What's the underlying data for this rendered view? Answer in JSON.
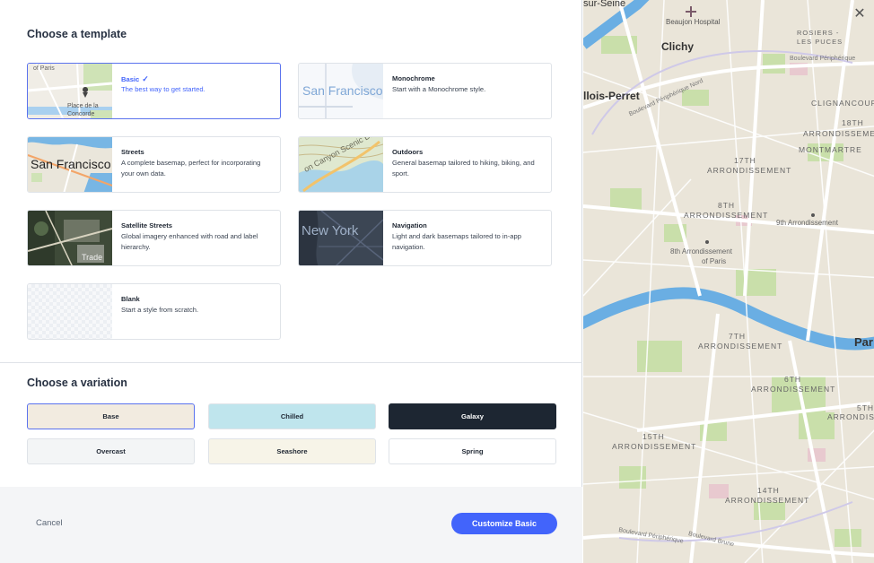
{
  "templates_title": "Choose a template",
  "variations_title": "Choose a variation",
  "templates": [
    {
      "id": "basic",
      "name": "Basic",
      "desc": "The best way to get started.",
      "thumb_text": [
        "Place de la",
        "Concorde",
        "of Paris"
      ],
      "selected": true
    },
    {
      "id": "monochrome",
      "name": "Monochrome",
      "desc": "Start with a Monochrome style.",
      "thumb_text": [
        "San Francisco"
      ]
    },
    {
      "id": "streets",
      "name": "Streets",
      "desc": "A complete basemap, perfect for incorporating your own data.",
      "thumb_text": [
        "San Francisco"
      ]
    },
    {
      "id": "outdoors",
      "name": "Outdoors",
      "desc": "General basemap tailored to hiking, biking, and sport.",
      "thumb_text": [
        "on Canyon Scenic Dr"
      ]
    },
    {
      "id": "satellite",
      "name": "Satellite Streets",
      "desc": "Global imagery enhanced with road and label hierarchy.",
      "thumb_text": [
        "Trade"
      ]
    },
    {
      "id": "navigation",
      "name": "Navigation",
      "desc": "Light and dark basemaps tailored to in-app navigation.",
      "thumb_text": [
        "New York"
      ]
    },
    {
      "id": "blank",
      "name": "Blank",
      "desc": "Start a style from scratch.",
      "thumb_text": []
    }
  ],
  "variations": [
    {
      "label": "Base",
      "bg": "#f2ebe0",
      "fg": "#1f2733",
      "selected": true
    },
    {
      "label": "Chilled",
      "bg": "#bfe5ed",
      "fg": "#1f2733"
    },
    {
      "label": "Galaxy",
      "bg": "#1d2632",
      "fg": "#ffffff"
    },
    {
      "label": "Overcast",
      "bg": "#f3f5f6",
      "fg": "#1f2733"
    },
    {
      "label": "Seashore",
      "bg": "#f7f4e8",
      "fg": "#1f2733"
    },
    {
      "label": "Spring",
      "bg": "#ffffff",
      "fg": "#1f2733"
    }
  ],
  "footer": {
    "cancel": "Cancel",
    "primary": "Customize Basic"
  },
  "colors": {
    "accent": "#4264fb",
    "water": "#6aaee3",
    "park": "#c5dca6",
    "land": "#eae5d9"
  },
  "map": {
    "labels": [
      {
        "text": "sur-Seine",
        "size": 11,
        "bold": false
      },
      {
        "text": "Beaujon Hospital",
        "size": 8
      },
      {
        "text": "Clichy",
        "size": 12,
        "bold": true
      },
      {
        "text": "ROSIERS -",
        "size": 7.5
      },
      {
        "text": "LES PUCES",
        "size": 7.5
      },
      {
        "text": "Boulevard Périphérique",
        "size": 7
      },
      {
        "text": "llois-Perret",
        "size": 12,
        "bold": true
      },
      {
        "text": "Boulevard Périphérique Nord",
        "size": 7
      },
      {
        "text": "CLIGNANCOURT",
        "size": 8.5
      },
      {
        "text": "18TH",
        "size": 8.5
      },
      {
        "text": "ARRONDISSEMENT",
        "size": 8.5
      },
      {
        "text": "MONTMARTRE",
        "size": 8.5
      },
      {
        "text": "17TH",
        "size": 8.5
      },
      {
        "text": "ARRONDISSEMENT",
        "size": 8.5
      },
      {
        "text": "8TH",
        "size": 8.5
      },
      {
        "text": "ARRONDISSEMENT",
        "size": 8.5
      },
      {
        "text": "9th Arrondissement",
        "size": 8
      },
      {
        "text": "8th Arrondissement",
        "size": 8
      },
      {
        "text": "of Paris",
        "size": 8
      },
      {
        "text": "Par",
        "size": 13,
        "bold": true
      },
      {
        "text": "7TH",
        "size": 8.5
      },
      {
        "text": "ARRONDISSEMENT",
        "size": 8.5
      },
      {
        "text": "6TH",
        "size": 8.5
      },
      {
        "text": "ARRONDISSEMENT",
        "size": 8.5
      },
      {
        "text": "5TH",
        "size": 8.5
      },
      {
        "text": "ARRONDISSEMENT",
        "size": 8.5
      },
      {
        "text": "15TH",
        "size": 8.5
      },
      {
        "text": "ARRONDISSEMENT",
        "size": 8.5
      },
      {
        "text": "14TH",
        "size": 8.5
      },
      {
        "text": "ARRONDISSEMENT",
        "size": 8.5
      },
      {
        "text": "Boulevard Brune",
        "size": 7
      },
      {
        "text": "Boulevard Périphérique",
        "size": 7
      }
    ]
  }
}
